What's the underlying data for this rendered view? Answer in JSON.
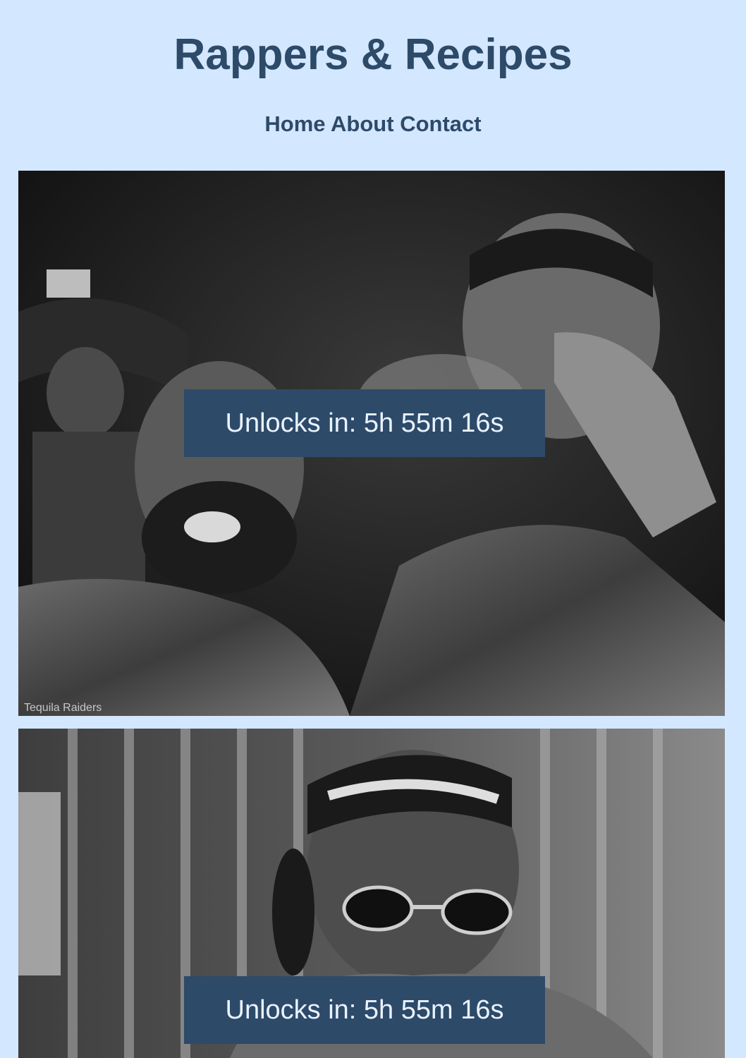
{
  "site": {
    "title": "Rappers & Recipes"
  },
  "nav": {
    "items": [
      {
        "label": "Home"
      },
      {
        "label": "About"
      },
      {
        "label": "Contact"
      }
    ]
  },
  "cards": [
    {
      "countdown": "Unlocks in: 5h 55m 16s",
      "watermark": "Tequila Raiders"
    },
    {
      "countdown": "Unlocks in: 5h 55m 16s"
    }
  ],
  "colors": {
    "background": "#d3e7ff",
    "accent": "#2d4a69",
    "overlay_text": "#e9f2ff"
  }
}
